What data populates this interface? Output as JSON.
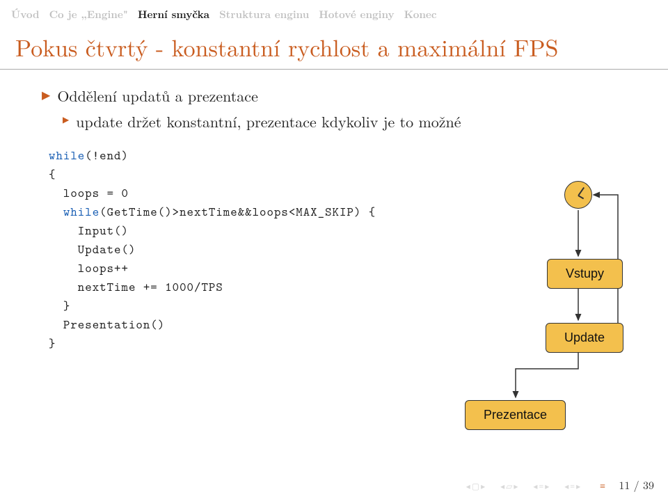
{
  "nav": {
    "items": [
      {
        "label": "Úvod",
        "active": false
      },
      {
        "label": "Co je „Engine\"",
        "active": false
      },
      {
        "label": "Herní smyčka",
        "active": true
      },
      {
        "label": "Struktura enginu",
        "active": false
      },
      {
        "label": "Hotové enginy",
        "active": false
      },
      {
        "label": "Konec",
        "active": false
      }
    ]
  },
  "title": "Pokus čtvrtý - konstantní rychlost a maximální FPS",
  "bullets": {
    "b1": "Oddělení updatů a prezentace",
    "b1a": "update držet konstantní, prezentace kdykoliv je to možné"
  },
  "code": {
    "l1a": "while",
    "l1b": "(!end)",
    "l2": "{",
    "l3": "  loops = 0",
    "l4a": "  ",
    "l4b": "while",
    "l4c": "(GetTime()>nextTime&&loops<MAX_SKIP) {",
    "l5": "    Input()",
    "l6": "    Update()",
    "l7": "    loops++",
    "l8": "    nextTime += 1000/TPS",
    "l9": "  }",
    "l10": "  Presentation()",
    "l11": "}"
  },
  "diagram": {
    "vstupy": "Vstupy",
    "update": "Update",
    "prezentace": "Prezentace"
  },
  "page": "11 / 39"
}
